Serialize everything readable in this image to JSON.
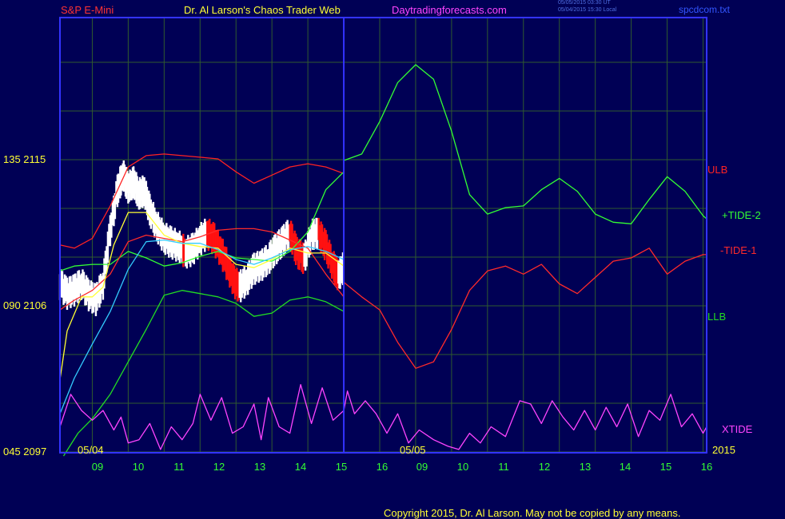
{
  "header": {
    "instrument": "S&P E-Mini",
    "site_title": "Dr. Al Larson's Chaos Trader Web",
    "site_url": "Daytradingforecasts.com",
    "timestamp_ut": "05/05/2015 03:30 UT",
    "timestamp_local": "05/04/2015 15:30 Local",
    "filename": "spcdcom.txt"
  },
  "colors": {
    "background": "#000055",
    "frame": "#3333ff",
    "grid": "#2f5a2f",
    "ulb": "#ff2222",
    "llb": "#22dd22",
    "tide_plus": "#33ff33",
    "tide_minus": "#ff2a2a",
    "xtide": "#ff44ff",
    "price_up": "#ffffff",
    "price_down": "#ff1111",
    "moving_avg_1": "#ffff33",
    "moving_avg_2": "#33ccff",
    "labels": "#ffff33",
    "hours": "#33ff33"
  },
  "copyright": "Copyright 2015, Dr. Al Larson. May not be copied by any means.",
  "chart_data": {
    "type": "line",
    "y_axis": {
      "ticks": [
        {
          "value": 2115,
          "label": "135  2115"
        },
        {
          "value": 2106,
          "label": "090  2106"
        },
        {
          "value": 2097,
          "label": "045  2097"
        }
      ],
      "ylim": [
        2097,
        2115
      ]
    },
    "x_axis": {
      "hour_ticks": [
        "09",
        "10",
        "11",
        "12",
        "13",
        "14",
        "15",
        "16",
        "09",
        "10",
        "11",
        "12",
        "13",
        "14",
        "15",
        "16"
      ],
      "day_labels": [
        "05/04",
        "05/05"
      ],
      "year_label": "2015",
      "day_divider_after_tick": 7
    },
    "grid": true,
    "legend": "right",
    "series": [
      {
        "name": "ULB",
        "color_key": "ulb",
        "values": [
          [
            8.1,
            2109.8
          ],
          [
            8.5,
            2109.6
          ],
          [
            9,
            2110.2
          ],
          [
            9.5,
            2112.2
          ],
          [
            10,
            2114.6
          ],
          [
            10.5,
            2115.3
          ],
          [
            11,
            2115.4
          ],
          [
            11.5,
            2115.3
          ],
          [
            12,
            2115.2
          ],
          [
            12.5,
            2115.1
          ],
          [
            13,
            2114.3
          ],
          [
            13.5,
            2113.6
          ],
          [
            14,
            2114.1
          ],
          [
            14.5,
            2114.6
          ],
          [
            15,
            2114.8
          ],
          [
            15.5,
            2114.6
          ],
          [
            16,
            2114.2
          ]
        ]
      },
      {
        "name": "LLB",
        "color_key": "llb",
        "values": [
          [
            8.2,
            2096.8
          ],
          [
            8.6,
            2098.2
          ],
          [
            9,
            2099.1
          ],
          [
            9.5,
            2100.6
          ],
          [
            10,
            2102.6
          ],
          [
            10.5,
            2104.6
          ],
          [
            11,
            2106.7
          ],
          [
            11.5,
            2107.0
          ],
          [
            12,
            2106.8
          ],
          [
            12.5,
            2106.6
          ],
          [
            13,
            2106.2
          ],
          [
            13.5,
            2105.4
          ],
          [
            14,
            2105.6
          ],
          [
            14.5,
            2106.4
          ],
          [
            15,
            2106.6
          ],
          [
            15.5,
            2106.3
          ],
          [
            16,
            2105.7
          ]
        ]
      },
      {
        "name": "+TIDE-2",
        "color_key": "tide_plus",
        "values": [
          [
            8.1,
            2108.2
          ],
          [
            8.5,
            2108.5
          ],
          [
            9,
            2108.6
          ],
          [
            9.5,
            2108.6
          ],
          [
            10,
            2109.4
          ],
          [
            10.5,
            2109.0
          ],
          [
            11,
            2108.5
          ],
          [
            11.5,
            2108.7
          ],
          [
            12,
            2109.1
          ],
          [
            12.5,
            2109.4
          ],
          [
            13,
            2109.0
          ],
          [
            13.5,
            2108.9
          ],
          [
            14,
            2108.8
          ],
          [
            14.5,
            2109.4
          ],
          [
            15,
            2110.6
          ],
          [
            15.5,
            2113.2
          ],
          [
            16,
            2114.3
          ],
          [
            16,
            2115.0
          ],
          [
            16.5,
            2115.4
          ],
          [
            17,
            2117.4
          ],
          [
            17.5,
            2119.8
          ],
          [
            18,
            2120.9
          ],
          [
            18.5,
            2120.0
          ],
          [
            19,
            2116.8
          ],
          [
            19.5,
            2112.9
          ],
          [
            20,
            2111.7
          ],
          [
            20.5,
            2112.1
          ],
          [
            21,
            2112.2
          ],
          [
            21.5,
            2113.2
          ],
          [
            22,
            2113.9
          ],
          [
            22.5,
            2113.1
          ],
          [
            23,
            2111.7
          ],
          [
            23.5,
            2111.2
          ],
          [
            24,
            2111.1
          ],
          [
            24.5,
            2112.6
          ],
          [
            25,
            2114.0
          ],
          [
            25.5,
            2113.1
          ],
          [
            26,
            2111.6
          ],
          [
            26.1,
            2111.4
          ],
          [
            26.1,
            2111.4
          ]
        ]
      },
      {
        "name": "-TIDE-1",
        "color_key": "tide_minus",
        "values": [
          [
            8.1,
            2105.8
          ],
          [
            8.5,
            2106.4
          ],
          [
            9,
            2107.0
          ],
          [
            9.5,
            2108.0
          ],
          [
            10,
            2110.0
          ],
          [
            10.5,
            2110.4
          ],
          [
            11,
            2110.2
          ],
          [
            11.5,
            2110.0
          ],
          [
            12,
            2110.3
          ],
          [
            12.5,
            2110.7
          ],
          [
            13,
            2110.8
          ],
          [
            13.5,
            2110.8
          ],
          [
            14,
            2110.6
          ],
          [
            14.5,
            2110.1
          ],
          [
            15,
            2109.6
          ],
          [
            15.5,
            2108.0
          ],
          [
            16,
            2106.6
          ],
          [
            16,
            2107.5
          ],
          [
            16.5,
            2106.6
          ],
          [
            17,
            2105.8
          ],
          [
            17.5,
            2103.8
          ],
          [
            18,
            2102.2
          ],
          [
            18.5,
            2102.6
          ],
          [
            19,
            2104.6
          ],
          [
            19.5,
            2107.0
          ],
          [
            20,
            2108.2
          ],
          [
            20.5,
            2108.5
          ],
          [
            21,
            2108.0
          ],
          [
            21.5,
            2108.6
          ],
          [
            22,
            2107.4
          ],
          [
            22.5,
            2106.8
          ],
          [
            23,
            2107.8
          ],
          [
            23.5,
            2108.8
          ],
          [
            24,
            2109.0
          ],
          [
            24.5,
            2109.6
          ],
          [
            25,
            2108.0
          ],
          [
            25.5,
            2108.8
          ],
          [
            26,
            2109.2
          ],
          [
            26.1,
            2109.2
          ]
        ]
      },
      {
        "name": "XTIDE",
        "color_key": "xtide",
        "values": [
          [
            8.1,
            2098.6
          ],
          [
            8.4,
            2100.6
          ],
          [
            8.7,
            2099.6
          ],
          [
            9,
            2099.0
          ],
          [
            9.3,
            2099.6
          ],
          [
            9.6,
            2098.4
          ],
          [
            9.8,
            2099.2
          ],
          [
            10,
            2097.6
          ],
          [
            10.3,
            2097.8
          ],
          [
            10.6,
            2098.8
          ],
          [
            10.9,
            2097.2
          ],
          [
            11.2,
            2098.6
          ],
          [
            11.5,
            2097.8
          ],
          [
            11.8,
            2098.8
          ],
          [
            12,
            2100.6
          ],
          [
            12.3,
            2099.0
          ],
          [
            12.6,
            2100.4
          ],
          [
            12.9,
            2098.2
          ],
          [
            13.2,
            2098.6
          ],
          [
            13.5,
            2100.0
          ],
          [
            13.7,
            2097.8
          ],
          [
            13.9,
            2100.4
          ],
          [
            14.2,
            2098.6
          ],
          [
            14.5,
            2098.2
          ],
          [
            14.8,
            2101.2
          ],
          [
            15.1,
            2098.8
          ],
          [
            15.4,
            2101.0
          ],
          [
            15.7,
            2099.0
          ],
          [
            16,
            2099.6
          ],
          [
            16.1,
            2100.8
          ],
          [
            16.3,
            2099.4
          ],
          [
            16.6,
            2100.2
          ],
          [
            16.9,
            2099.4
          ],
          [
            17.2,
            2098.2
          ],
          [
            17.5,
            2099.4
          ],
          [
            17.8,
            2097.6
          ],
          [
            18.1,
            2098.4
          ],
          [
            18.5,
            2097.8
          ],
          [
            18.9,
            2097.4
          ],
          [
            19.2,
            2097.2
          ],
          [
            19.5,
            2098.2
          ],
          [
            19.8,
            2097.6
          ],
          [
            20.1,
            2098.6
          ],
          [
            20.5,
            2098.0
          ],
          [
            20.9,
            2100.2
          ],
          [
            21.2,
            2100.0
          ],
          [
            21.5,
            2098.8
          ],
          [
            21.8,
            2100.2
          ],
          [
            22.1,
            2099.2
          ],
          [
            22.4,
            2098.4
          ],
          [
            22.7,
            2099.6
          ],
          [
            23.0,
            2098.4
          ],
          [
            23.3,
            2099.8
          ],
          [
            23.6,
            2098.6
          ],
          [
            23.9,
            2100.0
          ],
          [
            24.2,
            2098.0
          ],
          [
            24.5,
            2099.6
          ],
          [
            24.8,
            2099.0
          ],
          [
            25.1,
            2100.6
          ],
          [
            25.4,
            2098.6
          ],
          [
            25.7,
            2099.4
          ],
          [
            26.0,
            2098.2
          ],
          [
            26.1,
            2098.6
          ]
        ]
      },
      {
        "color_key": "moving_avg_1",
        "values": [
          [
            8.1,
            2101.5
          ],
          [
            8.3,
            2104.5
          ],
          [
            8.7,
            2106.6
          ],
          [
            9,
            2106.6
          ],
          [
            9.3,
            2107.2
          ],
          [
            9.6,
            2109.8
          ],
          [
            10,
            2111.8
          ],
          [
            10.5,
            2111.8
          ],
          [
            11,
            2110.4
          ],
          [
            11.5,
            2109.9
          ],
          [
            12,
            2109.7
          ],
          [
            12.5,
            2109.6
          ],
          [
            13,
            2108.6
          ],
          [
            13.5,
            2108.4
          ],
          [
            14,
            2108.9
          ],
          [
            14.5,
            2109.6
          ],
          [
            15,
            2109.3
          ],
          [
            15.5,
            2109.3
          ],
          [
            16,
            2108.5
          ]
        ]
      },
      {
        "color_key": "moving_avg_2",
        "values": [
          [
            8.1,
            2099.4
          ],
          [
            8.5,
            2101.6
          ],
          [
            9,
            2103.7
          ],
          [
            9.5,
            2105.7
          ],
          [
            10,
            2108.3
          ],
          [
            10.5,
            2110.0
          ],
          [
            11,
            2110.1
          ],
          [
            11.5,
            2109.9
          ],
          [
            12,
            2109.9
          ],
          [
            12.5,
            2109.5
          ],
          [
            13,
            2108.9
          ],
          [
            13.5,
            2108.6
          ],
          [
            14,
            2109.0
          ],
          [
            14.5,
            2109.5
          ],
          [
            15,
            2109.7
          ],
          [
            15.5,
            2109.4
          ],
          [
            16,
            2108.9
          ]
        ]
      }
    ],
    "price": {
      "color_up_key": "price_up",
      "color_down_key": "price_down",
      "values": [
        [
          8.1,
          2107.5
        ],
        [
          8.3,
          2106.9
        ],
        [
          8.5,
          2107.1
        ],
        [
          8.7,
          2107.5
        ],
        [
          8.9,
          2106.8
        ],
        [
          9.1,
          2106.5
        ],
        [
          9.3,
          2107.5
        ],
        [
          9.5,
          2110.8
        ],
        [
          9.7,
          2113.2
        ],
        [
          9.85,
          2114.2
        ],
        [
          10.0,
          2113.4
        ],
        [
          10.15,
          2113.7
        ],
        [
          10.3,
          2113.0
        ],
        [
          10.45,
          2113.2
        ],
        [
          10.6,
          2112.0
        ],
        [
          10.8,
          2111.0
        ],
        [
          11.0,
          2110.3
        ],
        [
          11.2,
          2110.0
        ],
        [
          11.4,
          2109.8
        ],
        [
          11.6,
          2109.4
        ],
        [
          11.8,
          2109.6
        ],
        [
          12.0,
          2110.2
        ],
        [
          12.2,
          2110.6
        ],
        [
          12.4,
          2110.2
        ],
        [
          12.6,
          2109.4
        ],
        [
          12.8,
          2108.4
        ],
        [
          12.95,
          2107.6
        ],
        [
          13.1,
          2107.3
        ],
        [
          13.3,
          2107.7
        ],
        [
          13.5,
          2108.4
        ],
        [
          13.7,
          2108.6
        ],
        [
          13.9,
          2109.0
        ],
        [
          14.1,
          2109.6
        ],
        [
          14.3,
          2110.1
        ],
        [
          14.5,
          2110.6
        ],
        [
          14.7,
          2109.4
        ],
        [
          14.9,
          2109.0
        ],
        [
          15.1,
          2110.5
        ],
        [
          15.3,
          2110.6
        ],
        [
          15.5,
          2109.8
        ],
        [
          15.7,
          2108.6
        ],
        [
          15.85,
          2108.0
        ],
        [
          16.0,
          2108.5
        ]
      ]
    }
  }
}
